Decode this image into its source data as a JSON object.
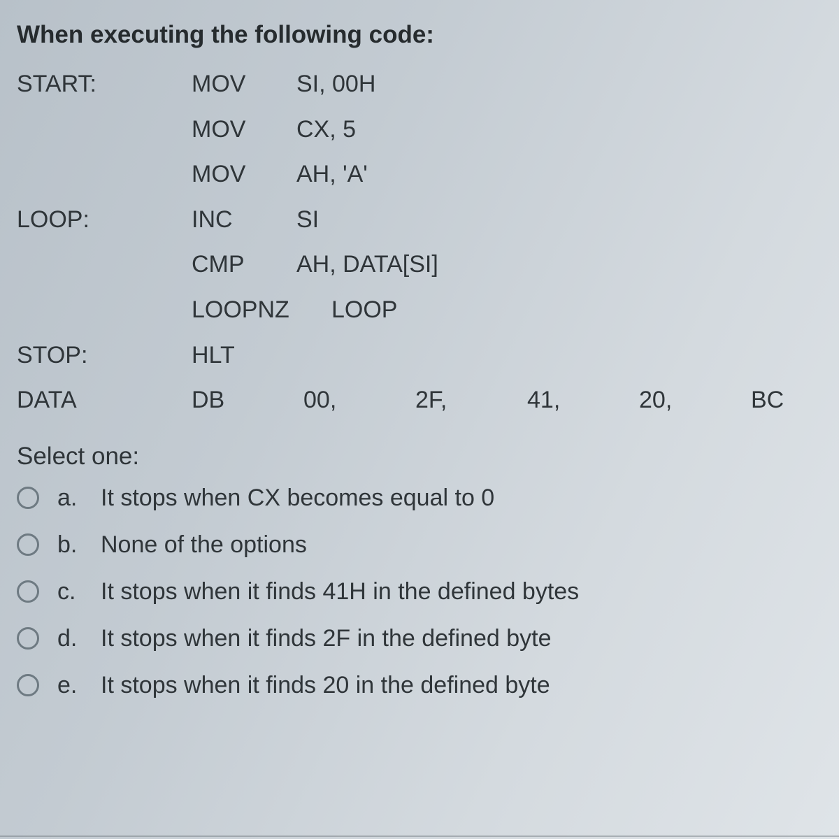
{
  "prompt": "When executing the following code:",
  "code": [
    {
      "label": "START:",
      "mnemonic": "MOV",
      "operands": "SI, 00H"
    },
    {
      "label": "",
      "mnemonic": "MOV",
      "operands": "CX, 5"
    },
    {
      "label": "",
      "mnemonic": "MOV",
      "operands": "AH, 'A'"
    },
    {
      "label": "LOOP:",
      "mnemonic": "INC",
      "operands": "SI"
    },
    {
      "label": "",
      "mnemonic": "CMP",
      "operands": "AH, DATA[SI]"
    },
    {
      "label": "",
      "mnemonic": "LOOPNZ",
      "operands": "LOOP"
    },
    {
      "label": "STOP:",
      "mnemonic": "HLT",
      "operands": ""
    }
  ],
  "data_line": {
    "label": "DATA",
    "mnemonic": "DB",
    "values": [
      "00,",
      "2F,",
      "41,",
      "20,",
      "BC"
    ]
  },
  "select": "Select one:",
  "options": [
    {
      "letter": "a.",
      "text": "It stops when CX becomes equal to 0"
    },
    {
      "letter": "b.",
      "text": "None of the options"
    },
    {
      "letter": "c.",
      "text": "It stops when it finds 41H in the defined bytes"
    },
    {
      "letter": "d.",
      "text": "It stops when it finds 2F in the defined byte"
    },
    {
      "letter": "e.",
      "text": "It stops when it finds 20 in the defined byte"
    }
  ]
}
